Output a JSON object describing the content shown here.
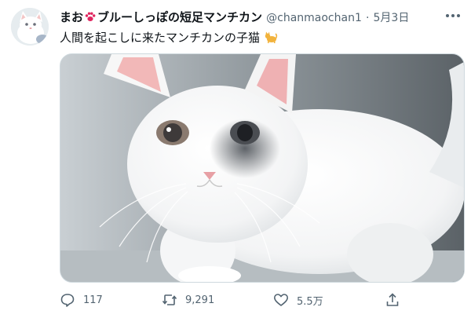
{
  "user": {
    "name_prefix": "まお",
    "name_suffix": "ブルーしっぽの短足マンチカン",
    "handle": "@chanmaochan1",
    "separator": "·",
    "date": "5月3日"
  },
  "tweet": {
    "text": "人間を起こしに来たマンチカンの子猫",
    "emoji": "cat-icon"
  },
  "actions": {
    "reply_count": "117",
    "retweet_count": "9,291",
    "like_count": "5.5万"
  },
  "colors": {
    "text_primary": "#0f1419",
    "text_secondary": "#536471",
    "border": "#cfd9de",
    "paw": "#e0245e",
    "cat_emoji": "#f2b33d"
  }
}
